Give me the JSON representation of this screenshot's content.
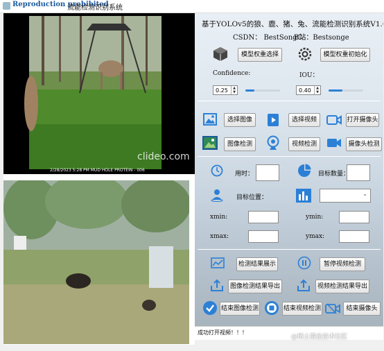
{
  "window": {
    "title": "流能检测识别系统",
    "watermark_over_title": "Reproduction prohibited"
  },
  "video1": {
    "caption": "2/28/2023   5:28 PM   MUD HOLE PROTEIN - 006",
    "watermark": "clideo.com"
  },
  "header": {
    "title": "基于YOLOv5的狼、鹿、猪、兔、流能检测识别系统V1.0",
    "csdn": "CSDN：  BestSongC",
    "bzhan": "B站：Bestsonge"
  },
  "model": {
    "select_label": "模型权重选择",
    "init_label": "模型权重初始化"
  },
  "params": {
    "confidence_label": "Confidence:",
    "confidence_value": "0.25",
    "confidence_fraction": 0.25,
    "iou_label": "IOU：",
    "iou_value": "0.40",
    "iou_fraction": 0.4
  },
  "actions": {
    "select_image": "选择图像",
    "select_video": "选择视频",
    "open_camera": "打开摄像头",
    "detect_image": "图像检测",
    "detect_video": "视频检测",
    "detect_camera": "摄像头检测"
  },
  "info": {
    "time_label": "用时：",
    "target_count_label": "目标数量：",
    "target_pos_label": "目标位置：",
    "xmin": "xmin:",
    "ymin": "ymin:",
    "xmax": "xmax:",
    "ymax": "ymax:"
  },
  "bottom": {
    "show_result": "检测结果展示",
    "pause_video": "暂停视频检测",
    "export_image": "图像检测结果导出",
    "export_video": "视频检测结果导出",
    "end_image": "结束图像检测",
    "end_video": "结束视频检测",
    "end_camera": "结束摄像头"
  },
  "status": {
    "text": "成功打开视频！！！"
  },
  "site_watermark": "@稀土掘金技术社区",
  "colors": {
    "accent": "#2b80d6"
  }
}
